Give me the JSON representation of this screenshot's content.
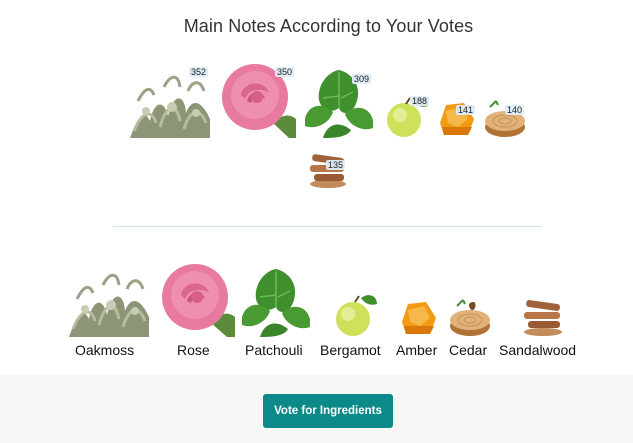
{
  "header": {
    "title": "Main Notes According to Your Votes"
  },
  "votes": [
    {
      "note": "Oakmoss",
      "count": "352",
      "icon": "oakmoss-icon"
    },
    {
      "note": "Rose",
      "count": "350",
      "icon": "rose-icon"
    },
    {
      "note": "Patchouli",
      "count": "309",
      "icon": "patchouli-icon"
    },
    {
      "note": "Bergamot",
      "count": "188",
      "icon": "bergamot-icon"
    },
    {
      "note": "Amber",
      "count": "141",
      "icon": "amber-icon"
    },
    {
      "note": "Cedar",
      "count": "140",
      "icon": "cedar-icon"
    },
    {
      "note": "Sandalwood",
      "count": "135",
      "icon": "sandalwood-icon"
    }
  ],
  "notes": [
    {
      "label": "Oakmoss",
      "icon": "oakmoss-icon"
    },
    {
      "label": "Rose",
      "icon": "rose-icon"
    },
    {
      "label": "Patchouli",
      "icon": "patchouli-icon"
    },
    {
      "label": "Bergamot",
      "icon": "bergamot-icon"
    },
    {
      "label": "Amber",
      "icon": "amber-icon"
    },
    {
      "label": "Cedar",
      "icon": "cedar-icon"
    },
    {
      "label": "Sandalwood",
      "icon": "sandalwood-icon"
    }
  ],
  "footer": {
    "vote_button_label": "Vote for Ingredients"
  },
  "colors": {
    "accent": "#0c8a8a",
    "divider": "#cfe3e8",
    "footer_bg": "#f7f7f7"
  }
}
